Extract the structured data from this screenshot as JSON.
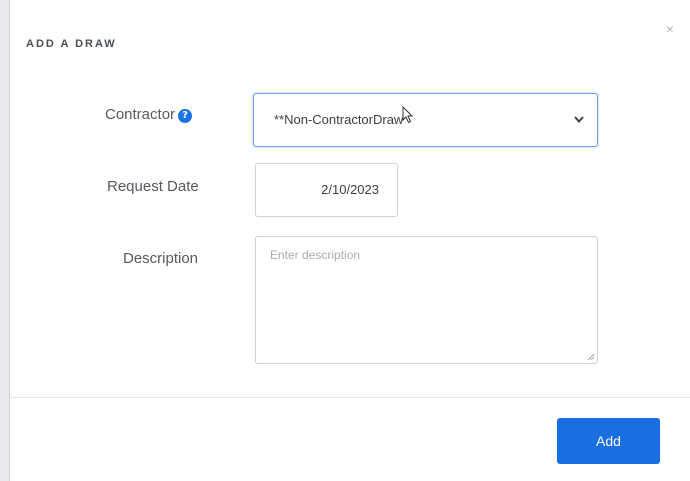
{
  "modal": {
    "title": "ADD A DRAW",
    "close_glyph": "×"
  },
  "form": {
    "contractor": {
      "label": "Contractor",
      "help_icon": "question-circle-icon",
      "selected_value": "**Non-ContractorDraw"
    },
    "request_date": {
      "label": "Request Date",
      "value": "2/10/2023"
    },
    "description": {
      "label": "Description",
      "placeholder": "Enter description",
      "value": ""
    }
  },
  "footer": {
    "add_label": "Add"
  },
  "colors": {
    "primary": "#1a6fe0",
    "help_icon": "#1a73e8",
    "focus_border": "#6a9fe6"
  }
}
